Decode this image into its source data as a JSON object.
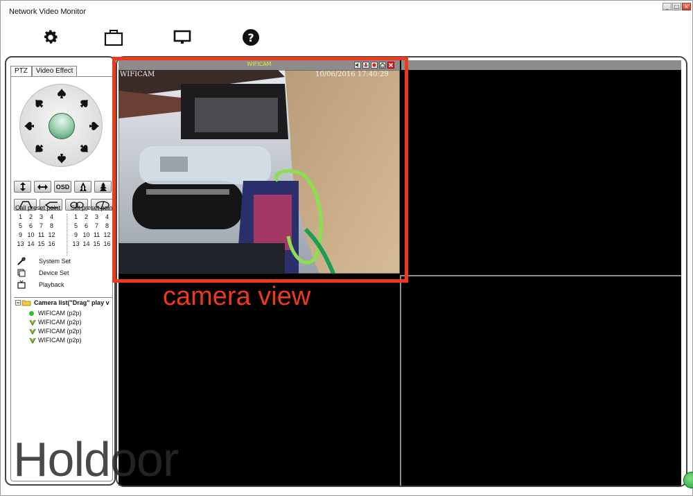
{
  "window": {
    "title": "Network Video Monitor",
    "controls": {
      "minimize": "_",
      "maximize": "□",
      "close": "×"
    }
  },
  "toolbar": {
    "buttons": [
      {
        "name": "settings",
        "icon": "gear-icon"
      },
      {
        "name": "record",
        "icon": "bag-icon"
      },
      {
        "name": "display",
        "icon": "monitor-icon"
      },
      {
        "name": "help",
        "icon": "help-icon"
      }
    ]
  },
  "left_panel": {
    "tabs": [
      {
        "label": "PTZ",
        "active": true
      },
      {
        "label": "Video Effect",
        "active": false
      }
    ],
    "ptz_buttons_row1": [
      {
        "icon": "vertical-flip-icon"
      },
      {
        "icon": "horizontal-flip-icon"
      },
      {
        "label": "OSD"
      },
      {
        "icon": "focus-near-icon"
      },
      {
        "icon": "focus-far-icon"
      }
    ],
    "ptz_buttons_row2": [
      {
        "icon": "zoom-in-icon"
      },
      {
        "icon": "zoom-out-icon"
      },
      {
        "icon": "cruise-icon"
      },
      {
        "icon": "iris-icon"
      }
    ],
    "call_preset": {
      "header": "Call preset point",
      "points": [
        "1",
        "2",
        "3",
        "4",
        "5",
        "6",
        "7",
        "8",
        "9",
        "10",
        "11",
        "12",
        "13",
        "14",
        "15",
        "16"
      ]
    },
    "set_preset": {
      "header": "Set preset point",
      "points": [
        "1",
        "2",
        "3",
        "4",
        "5",
        "6",
        "7",
        "8",
        "9",
        "10",
        "11",
        "12",
        "13",
        "14",
        "15",
        "16"
      ]
    },
    "menu": [
      {
        "label": "System Set",
        "icon": "tools-icon"
      },
      {
        "label": "Device Set",
        "icon": "device-icon"
      },
      {
        "label": "Playback",
        "icon": "playback-icon"
      }
    ],
    "camera_list": {
      "root_label": "Camera list(\"Drag\" play v",
      "items": [
        {
          "label": "WIFICAM (p2p)",
          "status": "online"
        },
        {
          "label": "WIFICAM (p2p)",
          "status": "signal"
        },
        {
          "label": "WIFICAM (p2p)",
          "status": "signal"
        },
        {
          "label": "WIFICAM (p2p)",
          "status": "signal"
        }
      ]
    }
  },
  "video_grid": {
    "active_camera": {
      "title": "WIFICAM",
      "osd_name": "WIFICAM",
      "osd_datetime": "10/06/2016  17:40:29"
    }
  },
  "annotation": {
    "label": "camera view",
    "color": "#ee3a1b"
  },
  "watermark": "Holdoor"
}
